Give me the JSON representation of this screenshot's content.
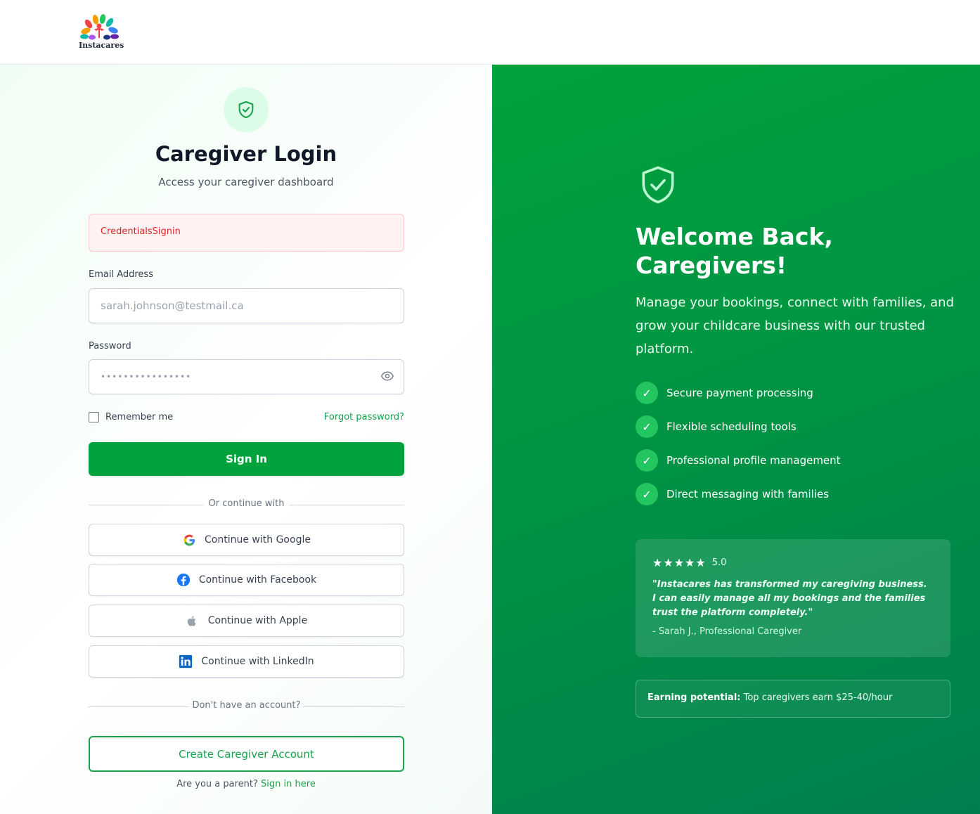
{
  "brand": {
    "name": "Instacares"
  },
  "login": {
    "title": "Caregiver Login",
    "subtitle": "Access your caregiver dashboard",
    "error": "CredentialsSignin",
    "email_label": "Email Address",
    "email_placeholder": "sarah.johnson@testmail.ca",
    "password_label": "Password",
    "password_value": "••••••••••••••••",
    "remember_label": "Remember me",
    "forgot_label": "Forgot password?",
    "signin_label": "Sign In",
    "continue_divider": "Or continue with",
    "social": [
      {
        "label": "Continue with Google",
        "icon": "google-icon"
      },
      {
        "label": "Continue with Facebook",
        "icon": "facebook-icon"
      },
      {
        "label": "Continue with Apple",
        "icon": "apple-icon"
      },
      {
        "label": "Continue with LinkedIn",
        "icon": "linkedin-icon"
      }
    ],
    "no_account_divider": "Don't have an account?",
    "create_label": "Create Caregiver Account",
    "parent_prompt": "Are you a parent?",
    "parent_link": "Sign in here"
  },
  "promo": {
    "welcome_title": "Welcome Back, Caregivers!",
    "description": "Manage your bookings, connect with families, and grow your childcare business with our trusted platform.",
    "features": [
      "Secure payment processing",
      "Flexible scheduling tools",
      "Professional profile management",
      "Direct messaging with families"
    ],
    "review": {
      "stars": 5,
      "rating": "5.0",
      "quote": "\"Instacares has transformed my caregiving business. I can easily manage all my bookings and the families trust the platform completely.\"",
      "author": "- Sarah J., Professional Caregiver"
    },
    "earning_label": "Earning potential:",
    "earning_text": "Top caregivers earn $25-40/hour"
  },
  "colors": {
    "primary_green": "#00a33b",
    "error_red": "#dc2626",
    "error_bg": "#fef2f2"
  }
}
